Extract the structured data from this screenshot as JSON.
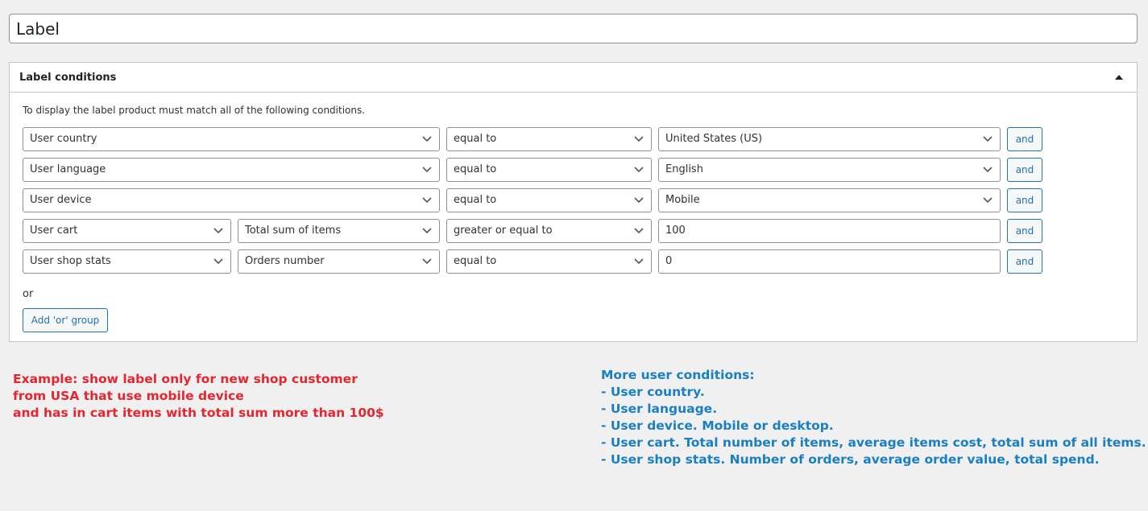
{
  "title_field": {
    "value": "Label"
  },
  "metabox": {
    "title": "Label conditions",
    "intro": "To display the label product must match all of the following conditions.",
    "rows": [
      {
        "field": "User country",
        "operator": "equal to",
        "value": "United States (US)",
        "and_label": "and"
      },
      {
        "field": "User language",
        "operator": "equal to",
        "value": "English",
        "and_label": "and"
      },
      {
        "field": "User device",
        "operator": "equal to",
        "value": "Mobile",
        "and_label": "and"
      },
      {
        "field": "User cart",
        "subfield": "Total sum of items",
        "operator": "greater or equal to",
        "value": "100",
        "and_label": "and"
      },
      {
        "field": "User shop stats",
        "subfield": "Orders number",
        "operator": "equal to",
        "value": "0",
        "and_label": "and"
      }
    ],
    "or_text": "or",
    "add_or_group_label": "Add 'or' group"
  },
  "example_note": {
    "lines": [
      "Example: show label only for new shop customer",
      "from USA that use mobile device",
      "and has in cart items with total sum more than 100$"
    ],
    "color": "#e3262f"
  },
  "more_conditions_note": {
    "lines": [
      "More user conditions:",
      "- User country.",
      "- User language.",
      "- User device. Mobile or desktop.",
      "- User cart. Total number of items, average items cost, total sum of all items.",
      "- User shop stats. Number of orders, average order value, total spend."
    ],
    "color": "#1a7fc1"
  },
  "colors": {
    "accent": "#2271b1",
    "border": "#c3c4c7",
    "background": "#f0f0f1"
  },
  "icons": {
    "toggle": "triangle-up-icon",
    "dropdown": "chevron-down-icon"
  }
}
